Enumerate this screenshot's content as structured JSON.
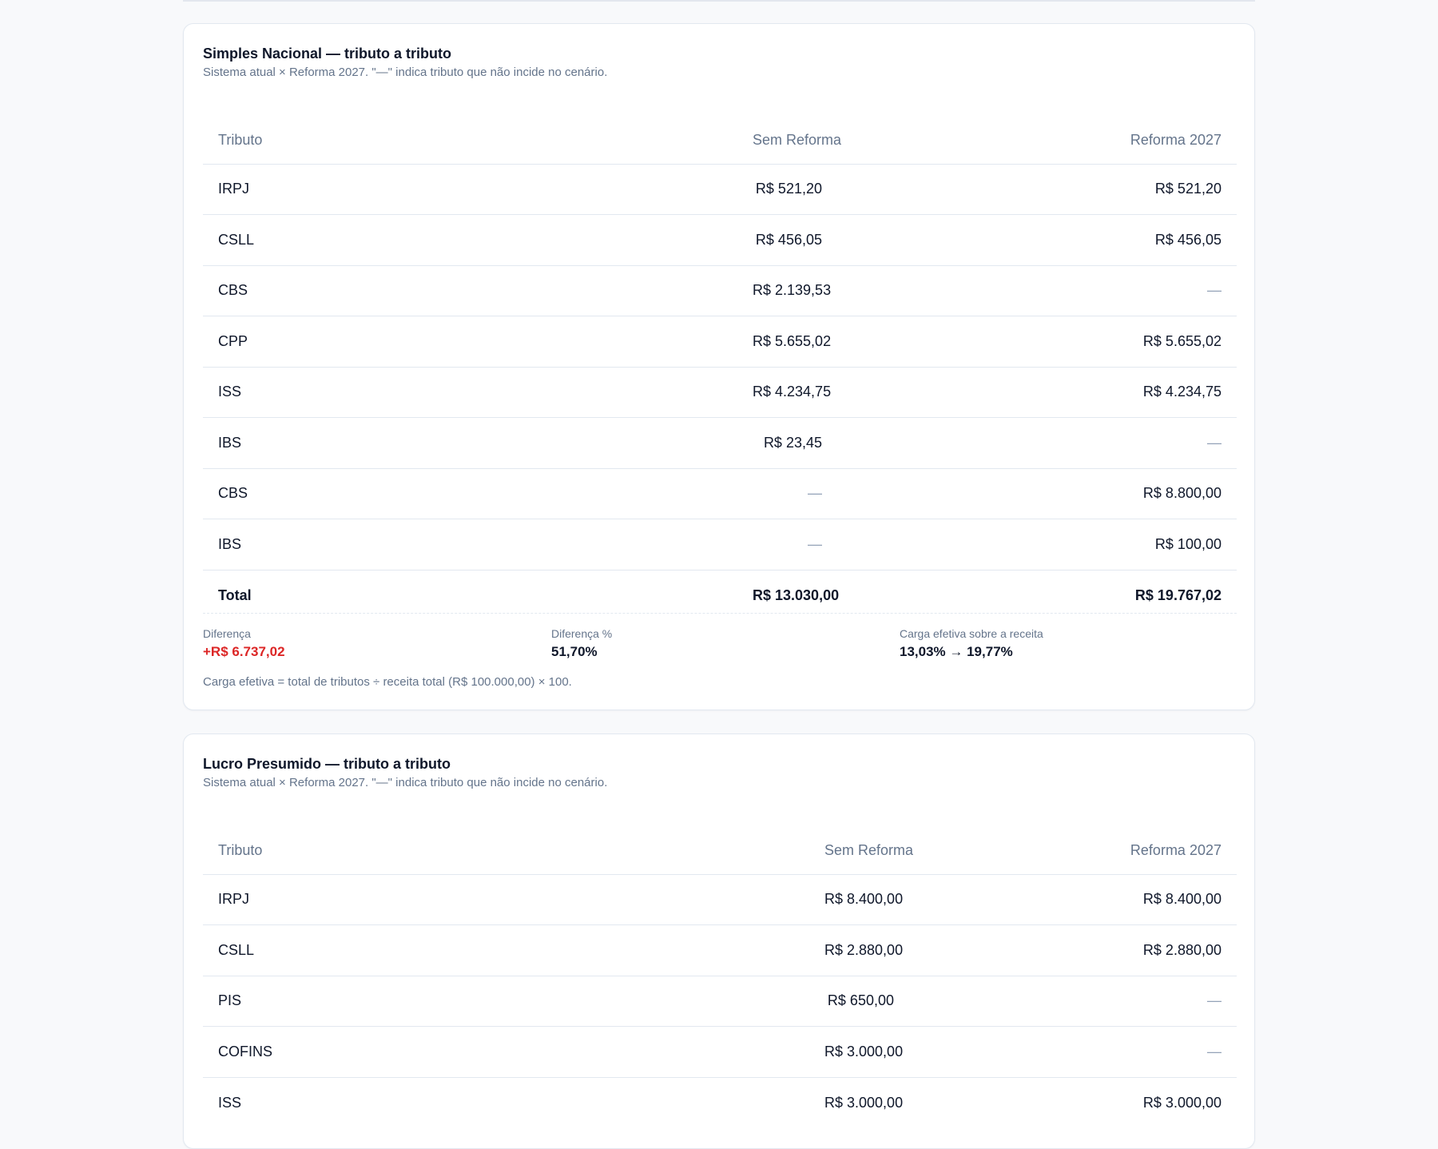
{
  "simples": {
    "title": "Simples Nacional — tributo a tributo",
    "subtitle": "Sistema atual × Reforma 2027. \"—\" indica tributo que não incide no cenário.",
    "headers": {
      "tributo": "Tributo",
      "sem_reforma": "Sem Reforma",
      "reforma": "Reforma 2027"
    },
    "rows": [
      {
        "tributo": "IRPJ",
        "sem_reforma": "R$ 521,20",
        "reforma": "R$ 521,20"
      },
      {
        "tributo": "CSLL",
        "sem_reforma": "R$ 456,05",
        "reforma": "R$ 456,05"
      },
      {
        "tributo": "CBS",
        "sem_reforma": "R$ 2.139,53",
        "reforma": "—"
      },
      {
        "tributo": "CPP",
        "sem_reforma": "R$ 5.655,02",
        "reforma": "R$ 5.655,02"
      },
      {
        "tributo": "ISS",
        "sem_reforma": "R$ 4.234,75",
        "reforma": "R$ 4.234,75"
      },
      {
        "tributo": "IBS",
        "sem_reforma": "R$ 23,45",
        "reforma": "—"
      },
      {
        "tributo": "CBS",
        "sem_reforma": "—",
        "reforma": "R$ 8.800,00"
      },
      {
        "tributo": "IBS",
        "sem_reforma": "—",
        "reforma": "R$ 100,00"
      }
    ],
    "total": {
      "label": "Total",
      "sem_reforma": "R$ 13.030,00",
      "reforma": "R$ 19.767,02"
    },
    "summary": {
      "diferenca_label": "Diferença",
      "diferenca_value": "+R$ 6.737,02",
      "diferenca_pct_label": "Diferença %",
      "diferenca_pct_value": "51,70%",
      "carga_label": "Carga efetiva sobre a receita",
      "carga_value": "13,03% → 19,77%"
    },
    "note": "Carga efetiva = total de tributos ÷ receita total (R$ 100.000,00) × 100."
  },
  "presumido": {
    "title": "Lucro Presumido — tributo a tributo",
    "subtitle": "Sistema atual × Reforma 2027. \"—\" indica tributo que não incide no cenário.",
    "headers": {
      "tributo": "Tributo",
      "sem_reforma": "Sem Reforma",
      "reforma": "Reforma 2027"
    },
    "rows": [
      {
        "tributo": "IRPJ",
        "sem_reforma": "R$ 8.400,00",
        "reforma": "R$ 8.400,00"
      },
      {
        "tributo": "CSLL",
        "sem_reforma": "R$ 2.880,00",
        "reforma": "R$ 2.880,00"
      },
      {
        "tributo": "PIS",
        "sem_reforma": "R$ 650,00",
        "reforma": "—"
      },
      {
        "tributo": "COFINS",
        "sem_reforma": "R$ 3.000,00",
        "reforma": "—"
      },
      {
        "tributo": "ISS",
        "sem_reforma": "R$ 3.000,00",
        "reforma": "R$ 3.000,00"
      }
    ]
  },
  "colors": {
    "negative": "#dc2626",
    "muted": "#64748b",
    "border": "#e2e8f0"
  }
}
